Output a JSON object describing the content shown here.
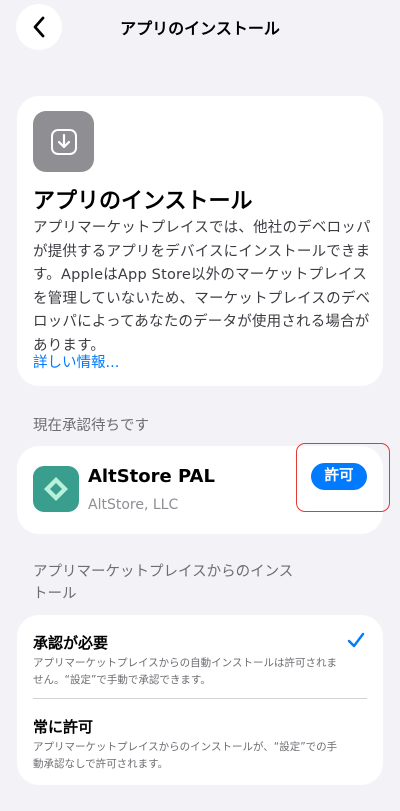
{
  "nav": {
    "title": "アプリのインストール",
    "back_icon": "chevron-left-icon"
  },
  "info": {
    "icon": "download-arrow-icon",
    "title": "アプリのインストール",
    "body": "アプリマーケットプレイスでは、他社のデベロッパが提供するアプリをデバイスにインストールできます。AppleはApp Store以外のマーケットプレイスを管理していないため、マーケットプレイスのデベロッパによってあなたのデータが使用される場合があります。",
    "link": "詳しい情報..."
  },
  "pending": {
    "header": "現在承認待ちです",
    "app_name": "AltStore PAL",
    "developer": "AltStore, LLC",
    "allow_label": "許可",
    "accent": "#007aff",
    "highlight_color": "#e53935"
  },
  "options": {
    "header": "アプリマーケットプレイスからのインストール",
    "items": [
      {
        "title": "承認が必要",
        "desc": "アプリマーケットプレイスからの自動インストールは許可されません。“設定”で手動で承認できます。",
        "selected": true
      },
      {
        "title": "常に許可",
        "desc": "アプリマーケットプレイスからのインストールが、“設定”での手動承認なしで許可されます。",
        "selected": false
      }
    ]
  }
}
